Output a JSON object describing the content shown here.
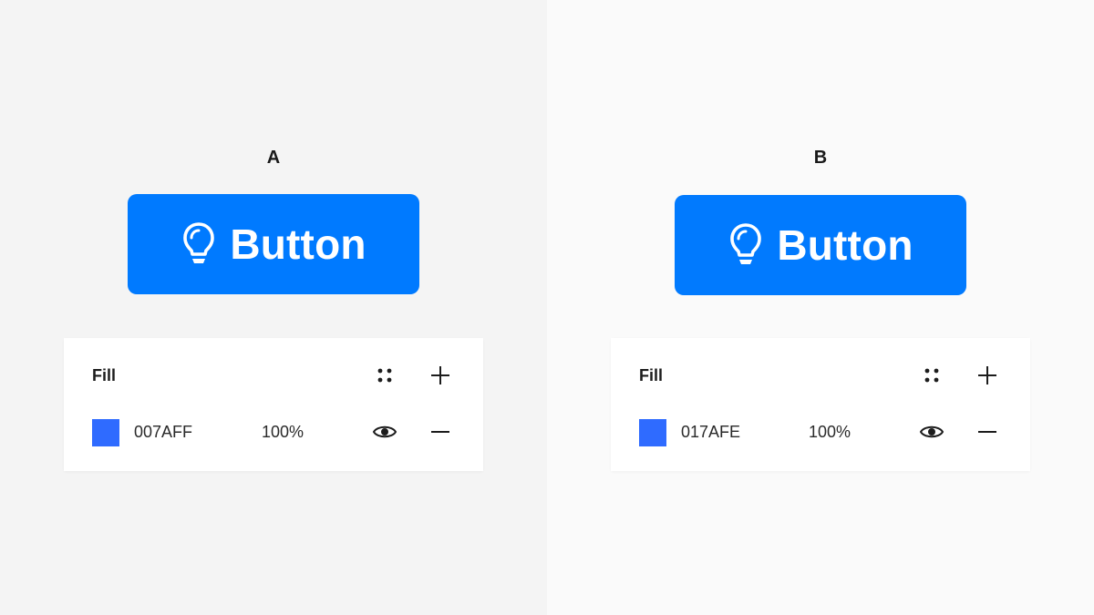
{
  "variants": [
    {
      "label": "A",
      "button": {
        "text": "Button",
        "color": "#007AFF",
        "icon": "lightbulb-icon"
      },
      "fill_panel": {
        "title": "Fill",
        "hex": "007AFF",
        "opacity": "100%",
        "swatch_color": "#2F6BFF",
        "icons": [
          "styles-grid-icon",
          "plus-icon",
          "eye-icon",
          "minus-icon"
        ]
      }
    },
    {
      "label": "B",
      "button": {
        "text": "Button",
        "color": "#017AFE",
        "icon": "lightbulb-icon"
      },
      "fill_panel": {
        "title": "Fill",
        "hex": "017AFE",
        "opacity": "100%",
        "swatch_color": "#2F6BFF",
        "icons": [
          "styles-grid-icon",
          "plus-icon",
          "eye-icon",
          "minus-icon"
        ]
      }
    }
  ],
  "colors": {
    "panel_a_background": "#F4F4F4",
    "panel_b_background": "#FAFAFA"
  }
}
